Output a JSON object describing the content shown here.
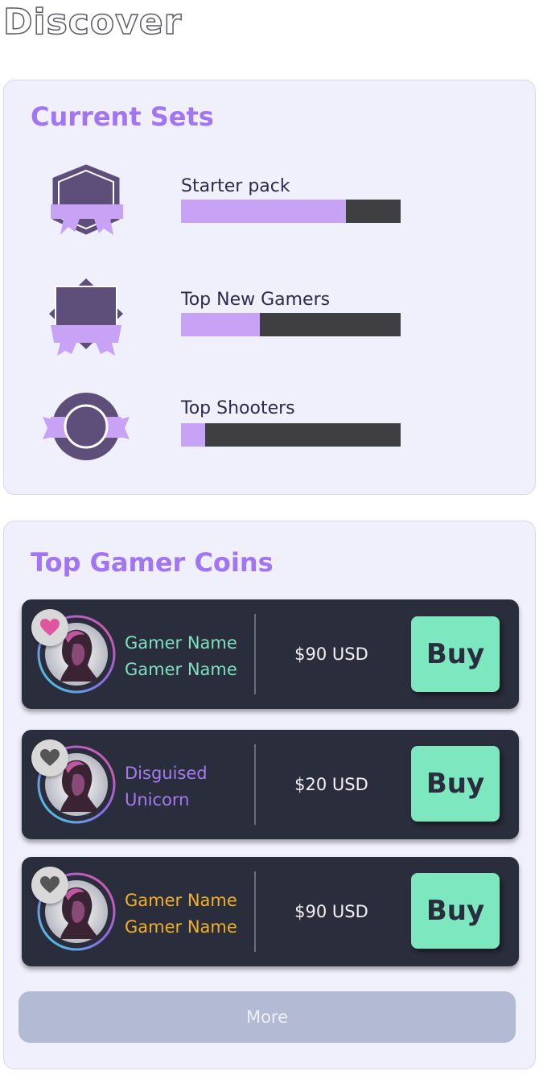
{
  "page": {
    "title": "Discover"
  },
  "current_sets": {
    "title": "Current Sets",
    "items": [
      {
        "label": "Starter pack",
        "progress": 0.75,
        "badge": "hexagon-ribbon-badge-icon"
      },
      {
        "label": "Top New Gamers",
        "progress": 0.36,
        "badge": "diamond-ribbon-badge-icon"
      },
      {
        "label": "Top Shooters",
        "progress": 0.11,
        "badge": "circle-ribbon-badge-icon"
      }
    ]
  },
  "top_coins": {
    "title": "Top Gamer Coins",
    "items": [
      {
        "name_line1": "Gamer Name",
        "name_line2": "Gamer Name",
        "name_color": "#7de0bf",
        "price": "$90 USD",
        "buy_label": "Buy",
        "favorited": true
      },
      {
        "name_line1": "Disguised",
        "name_line2": "Unicorn",
        "name_color": "#a57bf0",
        "price": "$20 USD",
        "buy_label": "Buy",
        "favorited": false
      },
      {
        "name_line1": "Gamer Name",
        "name_line2": "Gamer Name",
        "name_color": "#f2b125",
        "price": "$90 USD",
        "buy_label": "Buy",
        "favorited": false
      }
    ],
    "more_label": "More"
  },
  "colors": {
    "accent_purple": "#a275f2",
    "card_bg": "#f0effc",
    "row_bg": "#2a2d3c",
    "buy_green": "#7de8c0",
    "heart_active": "#e0559f",
    "heart_inactive": "#555555",
    "progress_fill": "#c8a2f5",
    "progress_track": "#3f3f42"
  }
}
